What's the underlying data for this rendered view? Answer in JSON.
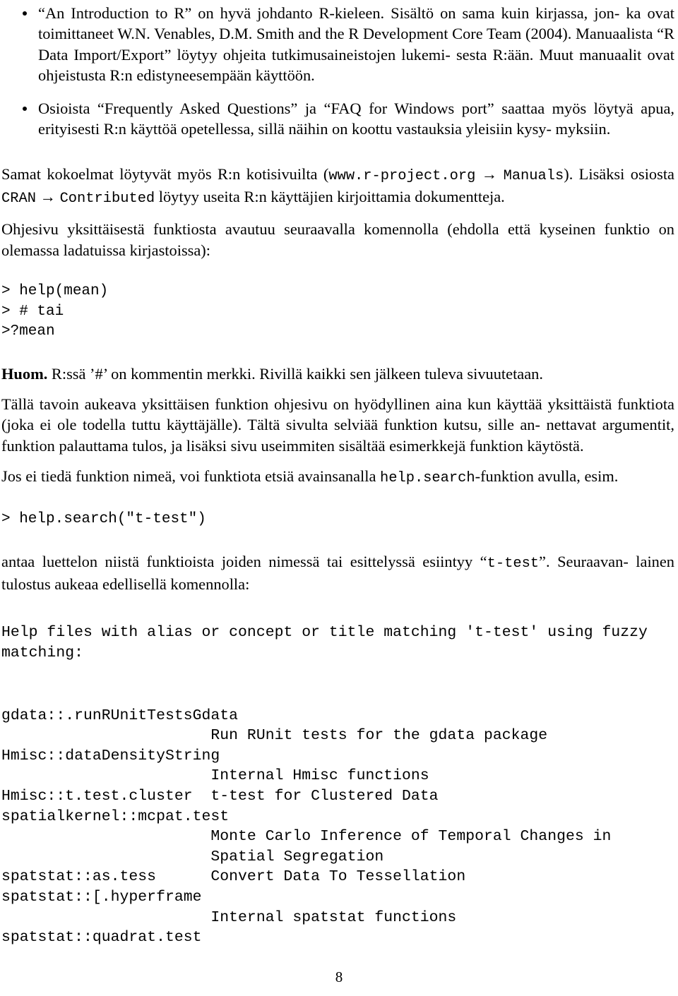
{
  "document": {
    "language": "fi",
    "page_number": "8"
  },
  "bullets": [
    {
      "id": "intro-to-r",
      "lines": [
        "“An Introduction to R” on hyvä johdanto R-kieleen. Sisältö on sama kuin kirjassa, jon-",
        "ka ovat toimittaneet W.N. Venables, D.M. Smith and the R Development Core Team",
        "(2004). Manuaalista “R Data Import/Export” löytyy ohjeita tutkimusaineistojen lukemi-",
        "sesta R:ään. Muut manuaalit ovat ohjeistusta R:n edistyneesempään käyttöön."
      ]
    },
    {
      "id": "faq",
      "lines": [
        "Osioista “Frequently Asked Questions” ja “FAQ for Windows port” saattaa myös löytyä",
        "apua, erityisesti R:n käyttöä opetellessa, sillä näihin on koottu vastauksia yleisiin kysy-",
        "myksiin."
      ]
    }
  ],
  "paragraphs": {
    "samat_kokoelmat": {
      "line1_pre": "Samat kokoelmat löytyvät myös R:n kotisivuilta (",
      "url": "www.r-project.org",
      "arrow": "→",
      "manuals": "Manuals",
      "line1_post": "). Lisäksi",
      "line2_pre": "osiosta ",
      "cran": "CRAN",
      "arrow2": "→",
      "contributed": "Contributed",
      "line2_post": " löytyy useita R:n käyttäjien kirjoittamia dokumentteja."
    },
    "ohjesivu": {
      "line1": "Ohjesivu yksittäisestä funktiosta avautuu seuraavalla komennolla (ehdolla että kyseinen funktio",
      "line2": "on olemassa ladatuissa kirjastoissa):"
    },
    "huom": {
      "bold": "Huom.",
      "rest": " R:ssä ’#’ on kommentin merkki. Rivillä kaikki sen jälkeen tuleva sivuutetaan."
    },
    "talla_tavoin": {
      "line1": "Tällä tavoin aukeava yksittäisen funktion ohjesivu on hyödyllinen aina kun käyttää yksittäistä",
      "line2": "funktiota (joka ei ole todella tuttu käyttäjälle). Tältä sivulta selviää funktion kutsu, sille an-",
      "line3": "nettavat argumentit, funktion palauttama tulos, ja lisäksi sivu useimmiten sisältää esimerkkejä",
      "line4": "funktion käytöstä."
    },
    "jos_ei_tieda": {
      "pre": "Jos ei tiedä funktion nimeä, voi funktiota etsiä avainsanalla ",
      "code": "help.search",
      "post": "-funktion avulla, esim."
    },
    "antaa_luettelon": {
      "line1_pre": "antaa luettelon niistä funktioista joiden nimessä tai esittelyssä esiintyy “",
      "code": "t-test",
      "line1_post": "”. Seuraavan-",
      "line2": "lainen tulostus aukeaa edellisellä komennolla:"
    }
  },
  "code_blocks": {
    "help_mean": "> help(mean)\n> # tai\n>?mean",
    "help_search": "> help.search(\"t-test\")"
  },
  "listing": {
    "header": "Help files with alias or concept or title matching 't-test' using fuzzy\nmatching:",
    "entries": [
      {
        "name": "gdata::.runRUnitTestsGdata",
        "desc": [
          "Run RUnit tests for the gdata package"
        ],
        "same_line": false
      },
      {
        "name": "Hmisc::dataDensityString",
        "desc": [
          "Internal Hmisc functions"
        ],
        "same_line": false
      },
      {
        "name": "Hmisc::t.test.cluster",
        "desc": [
          "t-test for Clustered Data"
        ],
        "same_line": true
      },
      {
        "name": "spatialkernel::mcpat.test",
        "desc": [
          "Monte Carlo Inference of Temporal Changes in",
          "Spatial Segregation"
        ],
        "same_line": false
      },
      {
        "name": "spatstat::as.tess",
        "desc": [
          "Convert Data To Tessellation"
        ],
        "same_line": true
      },
      {
        "name": "spatstat::[.hyperframe",
        "desc": [
          "Internal spatstat functions"
        ],
        "same_line": false
      },
      {
        "name": "spatstat::quadrat.test",
        "desc": [],
        "same_line": false
      }
    ],
    "desc_column": 23
  }
}
